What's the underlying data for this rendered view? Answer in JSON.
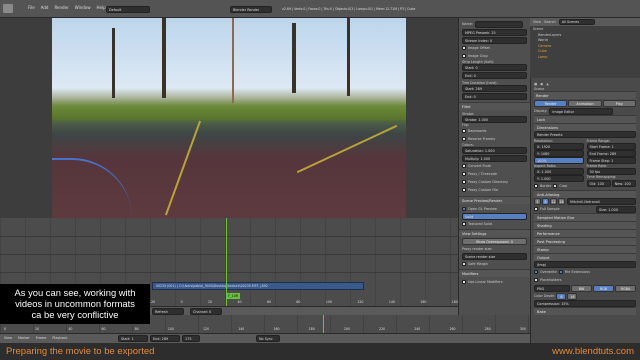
{
  "menu": {
    "items": [
      "File",
      "Add",
      "Render",
      "Window",
      "Help"
    ],
    "scene_layout": "Default",
    "render_engine": "Blender Render",
    "info": "v2.69 | Verts:0 | Faces:0 | Tris:0 | Objects:0/3 | Lamps:0/1 | Mem:12.71M | P3 | Cube"
  },
  "strip_panel": {
    "type_header": "Strip",
    "name_label": "Name:",
    "name_value": "",
    "mpeg_preset": "MPEG Preseek: 25",
    "stream_index": "Stream Index: 0",
    "image_offset": "Image Offset",
    "image_crop": "Image Crop",
    "strip_length_label": "Strip Length (Soft):",
    "start": "Start: 0",
    "end": "End: 0",
    "trim_label": "Trim Duration (hard):",
    "hard_start": "Start: 289",
    "hard_end": "End: 0",
    "filter_header": "Filter",
    "strobe_label": "Strobe:",
    "strobe_value": "Strobe: 1.000",
    "flip_label": "Flip:",
    "backwards": "Backwards",
    "reverse_frames": "Reverse Frames",
    "colors_label": "Colors:",
    "saturation": "Saturation: 1.000",
    "multiply": "Multiply: 1.000",
    "convert_float": "Convert Float",
    "use_proxy": "Proxy / Timecode",
    "proxy_directory": "Proxy Custom Directory",
    "proxy_file": "Proxy Custom File",
    "scene_preview_header": "Scene Preview/Render",
    "opengl_preview": "Open GL Preview",
    "solid": "Solid",
    "textured_solid": "Textured Solid",
    "view_settings_header": "View Settings",
    "show_overexposed": "Show Overexposed: 0",
    "proxy_render_size": "Proxy render size:",
    "proxy_size_value": "Scene render size",
    "safe_margin": "Safe Margin",
    "modifiers_header": "Modifiers",
    "use_linear": "Use Linear Modifiers"
  },
  "outliner": {
    "view": "All Scenes",
    "search_placeholder": "",
    "items": [
      "Scene",
      "RenderLayers",
      "World",
      "Camera",
      "Cube",
      "Lamp"
    ]
  },
  "render_props": {
    "header_scene": "Scene",
    "tabs": [
      "Render",
      "Animation",
      "Play"
    ],
    "display": "Display:",
    "display_value": "Image Editor",
    "lock": "Lock",
    "dimensions": "Dimensions",
    "render_presets": "Render Presets",
    "resolution": "Resolution:",
    "res_x": "X: 1920",
    "res_y": "Y: 1080",
    "res_pct": "100%",
    "frame_range": "Frame Range:",
    "start_frame": "Start Frame: 1",
    "end_frame": "End Frame: 289",
    "frame_step": "Frame Step: 1",
    "aspect_ratio": "Aspect Ratio:",
    "asp_x": "X: 1.000",
    "asp_y": "Y: 1.000",
    "frame_rate": "Frame Rate:",
    "fps_value": "30 fps",
    "time_remapping": "Time Remapping:",
    "old": "Old: 100",
    "new": "New: 100",
    "border": "Border",
    "crop": "Crop",
    "anti_aliasing": "Anti-Aliasing",
    "aa_samples": [
      "5",
      "8",
      "11",
      "16"
    ],
    "aa_filter": "Mitchell-Netravali",
    "full_sample": "Full Sample",
    "aa_size": "Size: 1.000",
    "sampled_motion_blur": "Sampled Motion Blur",
    "shading": "Shading",
    "performance": "Performance",
    "post_processing": "Post Processing",
    "stamp": "Stamp",
    "output": "Output",
    "output_path": "/tmp/",
    "overwrite": "Overwrite",
    "file_extensions": "File Extensions",
    "placeholders": "Placeholders",
    "file_format": "PNG",
    "color_modes": [
      "BW",
      "RGB",
      "RGBA"
    ],
    "color_depth": "Color Depth:",
    "depth_8": "8",
    "depth_16": "16",
    "compression": "Compression: 15%",
    "bake": "Bake"
  },
  "sequencer": {
    "strip_label": "00235 (001) | C:\\Users\\pablo\\_9000\\Desktop\\texture\\00235.MTS | 892",
    "frame_badge": "F_106",
    "timeline_numbers": [
      "-20",
      "0",
      "20",
      "40",
      "60",
      "80",
      "100",
      "120",
      "140",
      "160",
      "180",
      "200",
      "220",
      "240",
      "260"
    ],
    "header": [
      "View",
      "Select",
      "Marker",
      "Add",
      "Frame",
      "Strip"
    ],
    "refresh": "Refresh Sequencer",
    "channel": "Channel: 0"
  },
  "timeline": {
    "numbers": [
      "0",
      "20",
      "40",
      "60",
      "80",
      "100",
      "120",
      "140",
      "160",
      "180",
      "200",
      "220",
      "240",
      "260",
      "280",
      "300"
    ],
    "header": [
      "View",
      "Marker",
      "Frame",
      "Playback"
    ],
    "start": "Start: 1",
    "end": "End: 289",
    "current": "175",
    "sync": "No Sync"
  },
  "caption": {
    "line1": "As you can see, working with",
    "line2": "videos in uncommon formats",
    "line3": "ca be very conflictive"
  },
  "footer": {
    "left": "Preparing the movie to be exported",
    "right": "www.blendtuts.com"
  },
  "colors": {
    "accent": "#5680c2",
    "playhead": "#67c239",
    "footer_text": "#e48a3c",
    "strip": "#3a5a8c"
  }
}
